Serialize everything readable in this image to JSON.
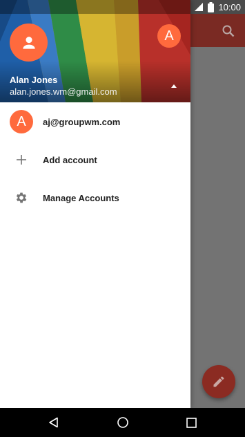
{
  "status_bar": {
    "time": "10:00"
  },
  "drawer": {
    "header": {
      "name": "Alan Jones",
      "email": "alan.jones.wm@gmail.com",
      "secondary_avatar_letter": "A"
    },
    "items": [
      {
        "label": "aj@groupwm.com",
        "avatar_letter": "A"
      },
      {
        "label": "Add account"
      },
      {
        "label": "Manage Accounts"
      }
    ]
  },
  "colors": {
    "accent": "#ff6a3d",
    "toolbar": "#7a2a23",
    "fab": "#8b2b22"
  }
}
